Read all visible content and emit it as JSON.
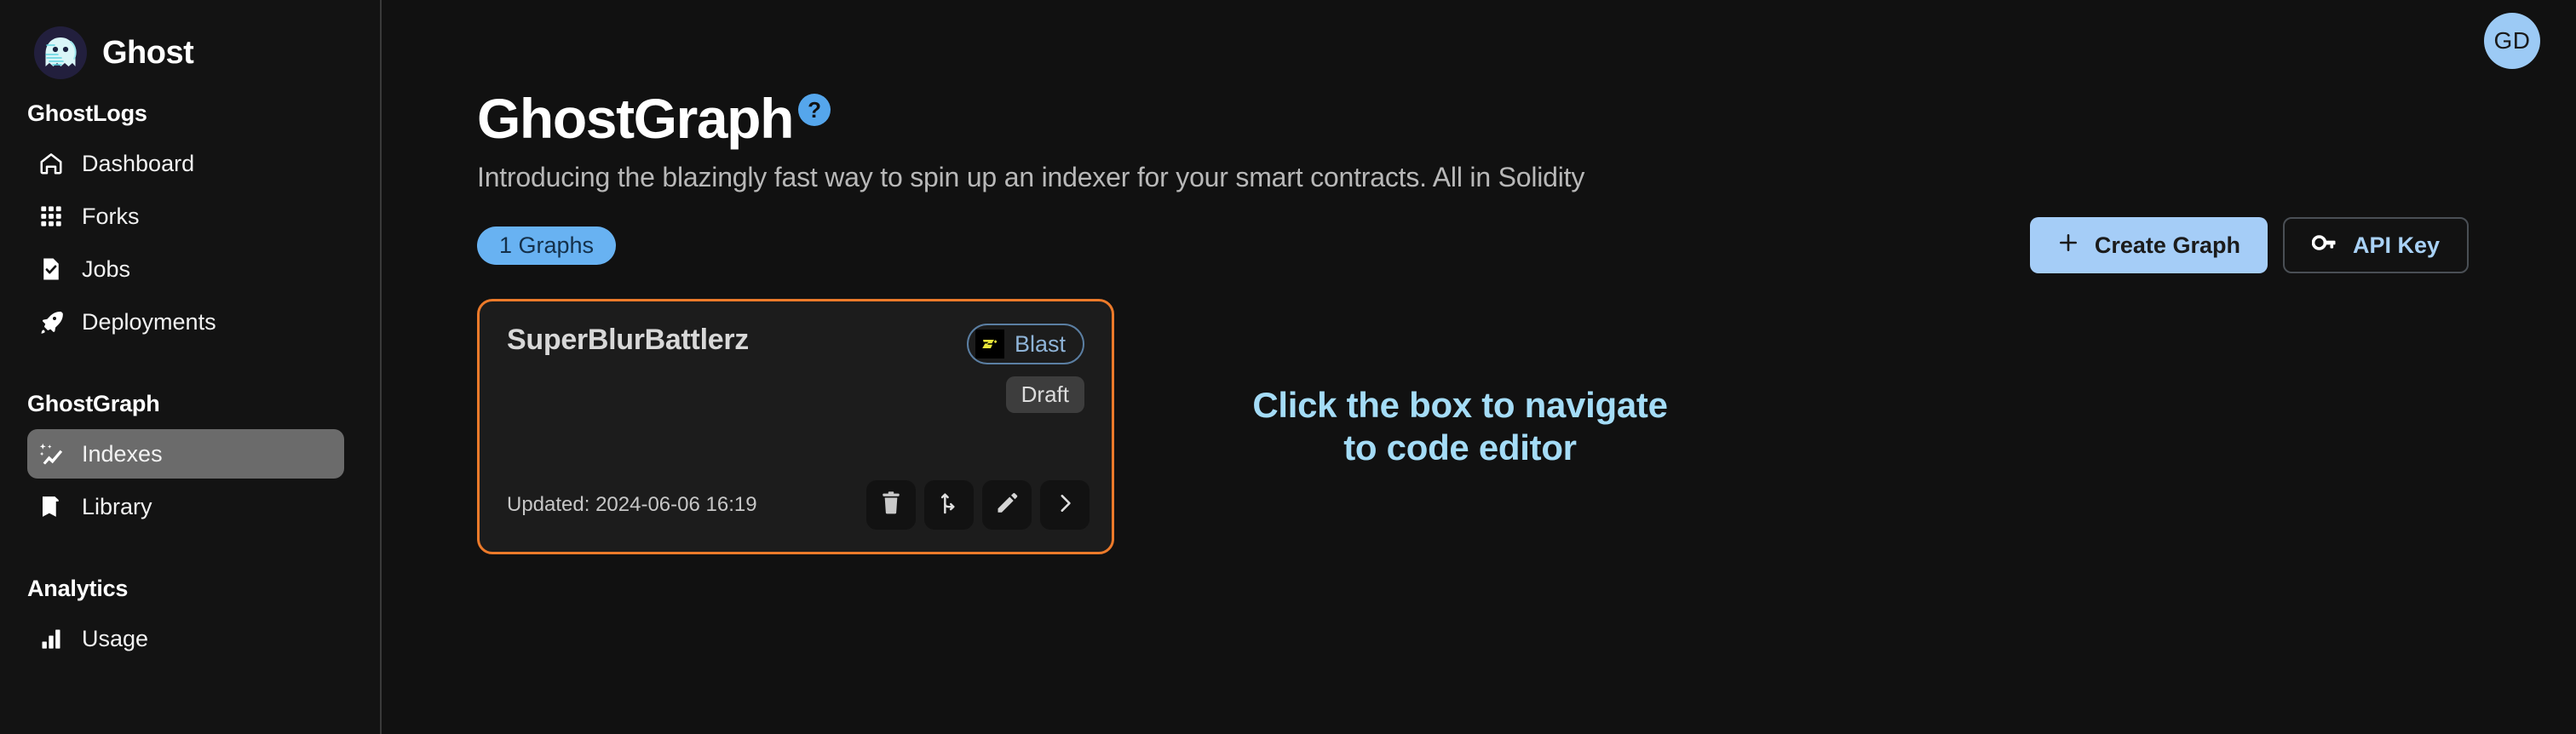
{
  "brand": {
    "name": "Ghost",
    "logo_icon": "ghost-logo-icon"
  },
  "sidebar": {
    "sections": [
      {
        "heading": "GhostLogs",
        "items": [
          {
            "label": "Dashboard",
            "icon": "home-icon",
            "active": false
          },
          {
            "label": "Forks",
            "icon": "grid-icon",
            "active": false
          },
          {
            "label": "Jobs",
            "icon": "file-check-icon",
            "active": false
          },
          {
            "label": "Deployments",
            "icon": "rocket-icon",
            "active": false
          }
        ]
      },
      {
        "heading": "GhostGraph",
        "items": [
          {
            "label": "Indexes",
            "icon": "sparkle-chart-icon",
            "active": true
          },
          {
            "label": "Library",
            "icon": "bookmark-icon",
            "active": false
          }
        ]
      },
      {
        "heading": "Analytics",
        "items": [
          {
            "label": "Usage",
            "icon": "bar-chart-icon",
            "active": false
          }
        ]
      }
    ]
  },
  "topbar": {
    "avatar_initials": "GD"
  },
  "page": {
    "title": "GhostGraph",
    "help_badge": "?",
    "subtitle": "Introducing the blazingly fast way to spin up an indexer for your smart contracts. All in Solidity"
  },
  "toolbar": {
    "graphs_count_label": "1 Graphs",
    "create_graph_label": "Create Graph",
    "create_graph_icon": "plus-icon",
    "api_key_label": "API Key",
    "api_key_icon": "key-icon"
  },
  "graph_card": {
    "title": "SuperBlurBattlerz",
    "chain_name": "Blast",
    "chain_logo_letter": "B",
    "status": "Draft",
    "updated_text": "Updated: 2024-06-06 16:19",
    "actions": [
      {
        "name": "delete",
        "icon": "trash-icon"
      },
      {
        "name": "fork",
        "icon": "branch-icon"
      },
      {
        "name": "edit",
        "icon": "pencil-icon"
      },
      {
        "name": "open",
        "icon": "chevron-right-icon"
      }
    ]
  },
  "annotation": {
    "line1": "Click the box to navigate",
    "line2": "to code editor"
  },
  "colors": {
    "background": "#111111",
    "sidebar": "#131313",
    "accent_blue": "#a5cdf7",
    "pill_blue": "#68b2f2",
    "highlight_orange": "#ec7a2a",
    "annotation_blue": "#a4dcf7",
    "active_nav": "#6b6b6b",
    "blast_yellow": "#e8e63a"
  }
}
